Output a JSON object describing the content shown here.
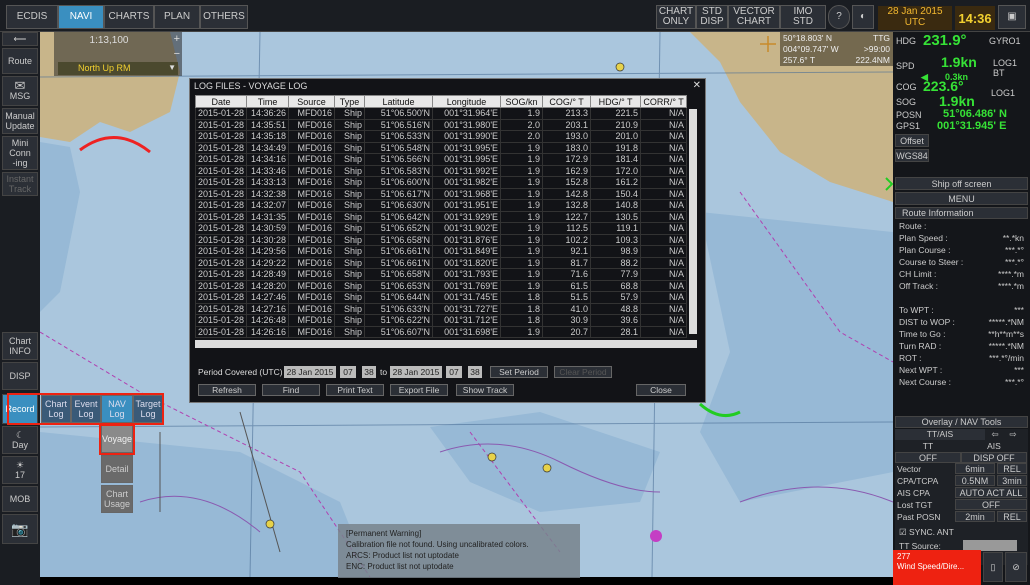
{
  "topbar": {
    "ecdis": "ECDIS",
    "tabs": [
      "NAVI",
      "CHARTS",
      "PLAN",
      "OTHERS"
    ],
    "right_buttons": [
      "CHART\nONLY",
      "STD\nDISP",
      "VECTOR\nCHART",
      "IMO\nSTD"
    ],
    "date": "28 Jan 2015",
    "tz": "UTC",
    "time": "14:36"
  },
  "scale_box": {
    "scale": "1:13,100",
    "mode": "North Up RM"
  },
  "left_buttons": [
    "Route",
    "MSG",
    "Manual\nUpdate",
    "Mini\nConn\n-ing",
    "Instant\nTrack",
    "Chart\nINFO",
    "DISP",
    "Record",
    "Day",
    "17",
    "MOB"
  ],
  "log_submenu": {
    "items": [
      "Chart\nLog",
      "Event\nLog",
      "NAV\nLog",
      "Target\nLog"
    ],
    "sub_items": [
      "Voyage",
      "Detail",
      "Chart\nUsage"
    ]
  },
  "cursor_box": {
    "lat": "50°18.803' N",
    "lon": "004°09.747' W",
    "brg": "257.6° T",
    "ttg_label": "TTG",
    "ttg": ">99:00",
    "dist": "222.4NM"
  },
  "nav": {
    "hdg_label": "HDG",
    "hdg": "231.9°",
    "hdg_src": "GYRO1",
    "spd_label": "SPD",
    "spd": "1.9kn",
    "spd_sub": "0.3kn",
    "spd_src": "LOG1\nBT",
    "cog_label": "COG",
    "cog": "223.6°",
    "sog_label": "SOG",
    "sog": "1.9kn",
    "sog_src": "LOG1",
    "posn_label": "POSN",
    "gps_label": "GPS1",
    "lat": "51°06.486' N",
    "lon": "001°31.945' E",
    "offset": "Offset",
    "datum": "WGS84",
    "ship_off": "Ship off screen",
    "menu": "MENU"
  },
  "route_info": {
    "title": "Route Information",
    "rows": [
      [
        "Route :",
        ""
      ],
      [
        "Plan Speed :",
        "**.*kn"
      ],
      [
        "Plan Course :",
        "***.*°"
      ],
      [
        "Course to Steer :",
        "***.*°"
      ],
      [
        "CH Limit :",
        "****.*m"
      ],
      [
        "Off Track :",
        "****.*m"
      ],
      [
        "",
        ""
      ],
      [
        "To WPT :",
        "***"
      ],
      [
        "DIST to WOP :",
        "*****.*NM"
      ],
      [
        "Time to Go :",
        "**h**m**s"
      ],
      [
        "Turn RAD :",
        "*****.*NM"
      ],
      [
        "ROT :",
        "***.*°/min"
      ],
      [
        "Next WPT :",
        "***"
      ],
      [
        "Next Course :",
        "***.*°"
      ]
    ]
  },
  "overlay": {
    "title": "Overlay / NAV Tools",
    "tt_ais": "TT/AIS",
    "tt": "TT",
    "ais": "AIS",
    "off": "OFF",
    "disp_off": "DISP OFF",
    "vector_label": "Vector",
    "vector_val": "6min",
    "rel": "REL",
    "cpa_label": "CPA/TCPA",
    "cpa_val": "0.5NM",
    "tcpa_val": "3min",
    "ais_cpa_label": "AIS CPA",
    "ais_cpa_val": "AUTO ACT ALL",
    "lost_label": "Lost TGT",
    "lost_val": "OFF",
    "past_label": "Past POSN",
    "past_val": "2min",
    "past_rel": "REL",
    "sync": "SYNC. ANT",
    "tt_source": "TT Source:"
  },
  "alarm": {
    "code": "277",
    "text": "Wind Speed/Dire..."
  },
  "dialog": {
    "title": "LOG FILES - VOYAGE LOG",
    "columns": [
      "Date",
      "Time",
      "Source",
      "Type",
      "Latitude",
      "Longitude",
      "SOG/kn",
      "COG/° T",
      "HDG/° T",
      "CORR/° T"
    ],
    "rows": [
      [
        "2015-01-28",
        "14:36:26",
        "MFD016",
        "Ship",
        "51°06.500'N",
        "001°31.964'E",
        "1.9",
        "213.3",
        "221.5",
        "N/A"
      ],
      [
        "2015-01-28",
        "14:35:51",
        "MFD016",
        "Ship",
        "51°06.516'N",
        "001°31.980'E",
        "2.0",
        "203.1",
        "210.9",
        "N/A"
      ],
      [
        "2015-01-28",
        "14:35:18",
        "MFD016",
        "Ship",
        "51°06.533'N",
        "001°31.990'E",
        "2.0",
        "193.0",
        "201.0",
        "N/A"
      ],
      [
        "2015-01-28",
        "14:34:49",
        "MFD016",
        "Ship",
        "51°06.548'N",
        "001°31.995'E",
        "1.9",
        "183.0",
        "191.8",
        "N/A"
      ],
      [
        "2015-01-28",
        "14:34:16",
        "MFD016",
        "Ship",
        "51°06.566'N",
        "001°31.995'E",
        "1.9",
        "172.9",
        "181.4",
        "N/A"
      ],
      [
        "2015-01-28",
        "14:33:46",
        "MFD016",
        "Ship",
        "51°06.583'N",
        "001°31.992'E",
        "1.9",
        "162.9",
        "172.0",
        "N/A"
      ],
      [
        "2015-01-28",
        "14:33:13",
        "MFD016",
        "Ship",
        "51°06.600'N",
        "001°31.982'E",
        "1.9",
        "152.8",
        "161.2",
        "N/A"
      ],
      [
        "2015-01-28",
        "14:32:38",
        "MFD016",
        "Ship",
        "51°06.617'N",
        "001°31.968'E",
        "1.9",
        "142.8",
        "150.4",
        "N/A"
      ],
      [
        "2015-01-28",
        "14:32:07",
        "MFD016",
        "Ship",
        "51°06.630'N",
        "001°31.951'E",
        "1.9",
        "132.8",
        "140.8",
        "N/A"
      ],
      [
        "2015-01-28",
        "14:31:35",
        "MFD016",
        "Ship",
        "51°06.642'N",
        "001°31.929'E",
        "1.9",
        "122.7",
        "130.5",
        "N/A"
      ],
      [
        "2015-01-28",
        "14:30:59",
        "MFD016",
        "Ship",
        "51°06.652'N",
        "001°31.902'E",
        "1.9",
        "112.5",
        "119.1",
        "N/A"
      ],
      [
        "2015-01-28",
        "14:30:28",
        "MFD016",
        "Ship",
        "51°06.658'N",
        "001°31.876'E",
        "1.9",
        "102.2",
        "109.3",
        "N/A"
      ],
      [
        "2015-01-28",
        "14:29:56",
        "MFD016",
        "Ship",
        "51°06.661'N",
        "001°31.849'E",
        "1.9",
        "92.1",
        "98.9",
        "N/A"
      ],
      [
        "2015-01-28",
        "14:29:22",
        "MFD016",
        "Ship",
        "51°06.661'N",
        "001°31.820'E",
        "1.9",
        "81.7",
        "88.2",
        "N/A"
      ],
      [
        "2015-01-28",
        "14:28:49",
        "MFD016",
        "Ship",
        "51°06.658'N",
        "001°31.793'E",
        "1.9",
        "71.6",
        "77.9",
        "N/A"
      ],
      [
        "2015-01-28",
        "14:28:20",
        "MFD016",
        "Ship",
        "51°06.653'N",
        "001°31.769'E",
        "1.9",
        "61.5",
        "68.8",
        "N/A"
      ],
      [
        "2015-01-28",
        "14:27:46",
        "MFD016",
        "Ship",
        "51°06.644'N",
        "001°31.745'E",
        "1.8",
        "51.5",
        "57.9",
        "N/A"
      ],
      [
        "2015-01-28",
        "14:27:16",
        "MFD016",
        "Ship",
        "51°06.633'N",
        "001°31.727'E",
        "1.8",
        "41.0",
        "48.8",
        "N/A"
      ],
      [
        "2015-01-28",
        "14:26:48",
        "MFD016",
        "Ship",
        "51°06.622'N",
        "001°31.712'E",
        "1.8",
        "30.9",
        "39.6",
        "N/A"
      ],
      [
        "2015-01-28",
        "14:26:16",
        "MFD016",
        "Ship",
        "51°06.607'N",
        "001°31.698'E",
        "1.9",
        "20.7",
        "28.1",
        "N/A"
      ]
    ],
    "period_label": "Period Covered (UTC) :",
    "from_date": "28 Jan 2015",
    "from_h": "07",
    "from_m": "38",
    "to": "to",
    "to_date": "28 Jan 2015",
    "to_h": "07",
    "to_m": "38",
    "set_period": "Set Period",
    "clear_period": "Clear Period",
    "buttons": [
      "Refresh",
      "Find",
      "Print Text",
      "Export File",
      "Show Track",
      "Close"
    ]
  },
  "warning": {
    "lines": [
      "[Permanent Warning]",
      "Calibration file not found. Using uncalibrated colors.",
      "ARCS: Product list not uptodate",
      "ENC: Product list not uptodate"
    ]
  }
}
